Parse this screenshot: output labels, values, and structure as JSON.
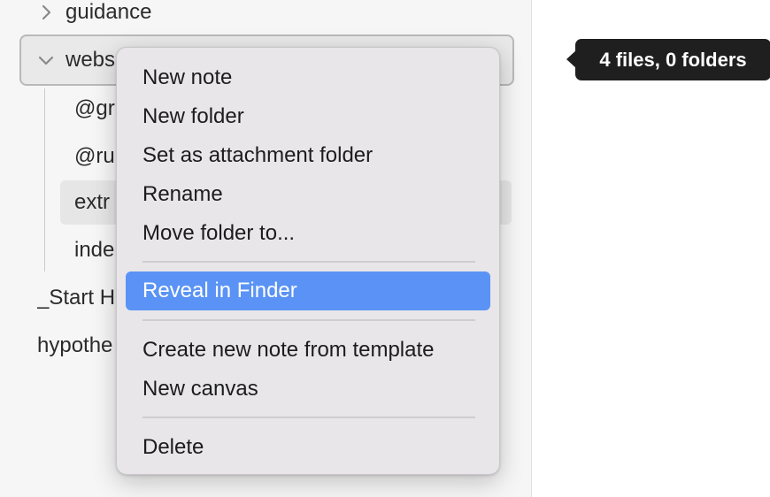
{
  "sidebar": {
    "items": [
      {
        "label": "guidance",
        "chevron": "chevron-right-icon"
      },
      {
        "label": "webs",
        "chevron": "chevron-down-icon"
      },
      {
        "label": "@gr"
      },
      {
        "label": "@ru"
      },
      {
        "label": "extr"
      },
      {
        "label": "inde"
      },
      {
        "label": "_Start H"
      },
      {
        "label": "hypothe"
      }
    ]
  },
  "tooltip": {
    "text": "4 files, 0 folders"
  },
  "context_menu": {
    "items": [
      {
        "label": "New note"
      },
      {
        "label": "New folder"
      },
      {
        "label": "Set as attachment folder"
      },
      {
        "label": "Rename"
      },
      {
        "label": "Move folder to..."
      },
      {
        "label": "Reveal in Finder",
        "highlighted": true
      },
      {
        "label": "Create new note from template"
      },
      {
        "label": "New canvas"
      },
      {
        "label": "Delete"
      }
    ]
  },
  "colors": {
    "highlight": "#5a93f5",
    "menu_bg": "#e8e6e9",
    "tooltip_bg": "#1f1f1f"
  }
}
